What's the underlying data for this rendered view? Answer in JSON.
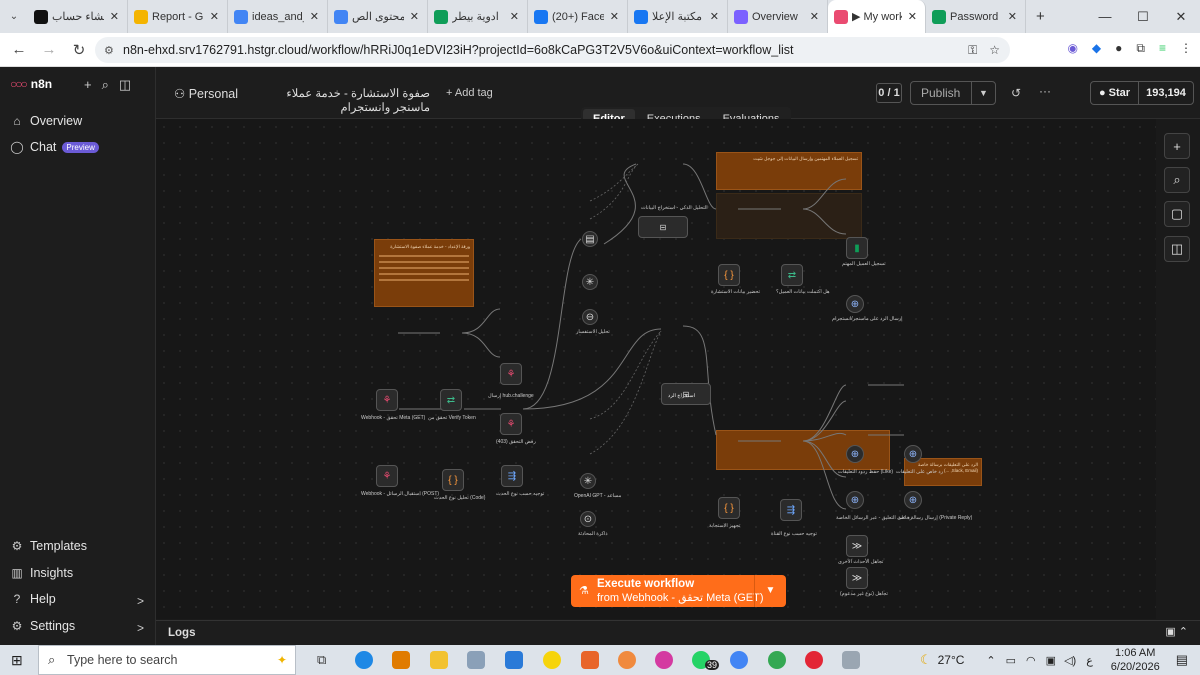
{
  "browser": {
    "tabs": [
      {
        "title": "إنشاء حساب",
        "color": "#111111"
      },
      {
        "title": "Report - G",
        "color": "#f4b400"
      },
      {
        "title": "ideas_and_",
        "color": "#4285f4"
      },
      {
        "title": "محتوى الص",
        "color": "#4285f4"
      },
      {
        "title": "ادوية بيطر",
        "color": "#0f9d58"
      },
      {
        "title": "(20+) Face",
        "color": "#1877f2"
      },
      {
        "title": "مكتبة الإعلا",
        "color": "#1877f2"
      },
      {
        "title": "Overview",
        "color": "#7b61ff"
      },
      {
        "title": "▶ My work",
        "color": "#ea4b71"
      },
      {
        "title": "Password",
        "color": "#0f9d58"
      }
    ],
    "new_tab": "+",
    "url": "n8n-ehxd.srv1762791.hstgr.cloud/workflow/hRRiJ0q1eDVI23iH?projectId=6o8kCaPG3T2V5V6o&uiContext=workflow_list"
  },
  "sidebar": {
    "brand": "n8n",
    "items": [
      {
        "label": "Overview",
        "icon": "home-icon"
      },
      {
        "label": "Chat",
        "icon": "chat-icon",
        "badge": "Preview"
      }
    ],
    "bottom": [
      {
        "label": "Templates",
        "icon": "templates-icon"
      },
      {
        "label": "Insights",
        "icon": "insights-icon"
      },
      {
        "label": "Help",
        "icon": "help-icon",
        "chevron": ">"
      },
      {
        "label": "Settings",
        "icon": "gear-icon",
        "chevron": ">"
      }
    ]
  },
  "header": {
    "project": "Personal",
    "workflow_name": "صفوة الاستشارة - خدمة عملاء ماسنجر وانستجرام",
    "add_tag": "+ Add tag",
    "counter": "0 / 1",
    "publish": "Publish",
    "github_star": "Star",
    "github_count": "193,194",
    "tabs": [
      "Editor",
      "Executions",
      "Evaluations"
    ],
    "active_tab": "Editor"
  },
  "canvas": {
    "nodes": [
      {
        "label": "Webhook - تحقق Meta (GET)"
      },
      {
        "label": "تحقق من Verify Token"
      },
      {
        "label": "إرسال hub.challenge"
      },
      {
        "label": "رفض التحقق (403)"
      },
      {
        "label": "Webhook - استقبال الرسائل (POST)"
      },
      {
        "label": "تحليل نوع الحدث (Code)"
      },
      {
        "label": "توجيه حسب نوع الحدث"
      },
      {
        "label": "OpenAI GPT - مساعد"
      },
      {
        "label": "ذاكرة المحادثة"
      },
      {
        "label": "تحليل الاستفسار"
      },
      {
        "label": "التحليل الذكي - استخراج البيانات"
      },
      {
        "label": "تحضير بيانات الاستشارة"
      },
      {
        "label": "هل اكتملت بيانات العميل؟"
      },
      {
        "label": "تسجيل العميل المهتم"
      },
      {
        "label": "إرسال الرد على ماسنجر/انستجرام"
      },
      {
        "label": "استخراج الرد"
      },
      {
        "label": "تجهيز الاستجابة"
      },
      {
        "label": "توجيه حسب نوع القناة"
      },
      {
        "label": "حفظ ردود التعليقات (Like)"
      },
      {
        "label": "رد خاص على التعليقات"
      },
      {
        "label": "رد على التعليق - عبر الرسائل الخاصة"
      },
      {
        "label": "إرسال رسالة خاصة (Private Reply)"
      },
      {
        "label": "تجاهل الأحداث الأخرى"
      },
      {
        "label": "تجاهل (نوع غير مدعوم)"
      }
    ],
    "notes": [
      {
        "text": "ورقة الإعداد - خدمة عملاء صفوة الاستشارة"
      },
      {
        "text": "تسجيل العملاء المهتمين وإرسال البيانات إلى جوجل شيت"
      },
      {
        "text": "الرد على التعليقات برسالة خاصة (Slack, Email, ...)"
      }
    ]
  },
  "execute": {
    "line1": "Execute workflow",
    "line2": "from Webhook - تحقق Meta (GET)"
  },
  "logs": {
    "label": "Logs"
  },
  "taskbar": {
    "search_placeholder": "Type here to search",
    "weather": "27°C",
    "time": "1:06 AM",
    "date": "6/20/2026",
    "lang": "ع",
    "whatsapp_count": "39"
  }
}
